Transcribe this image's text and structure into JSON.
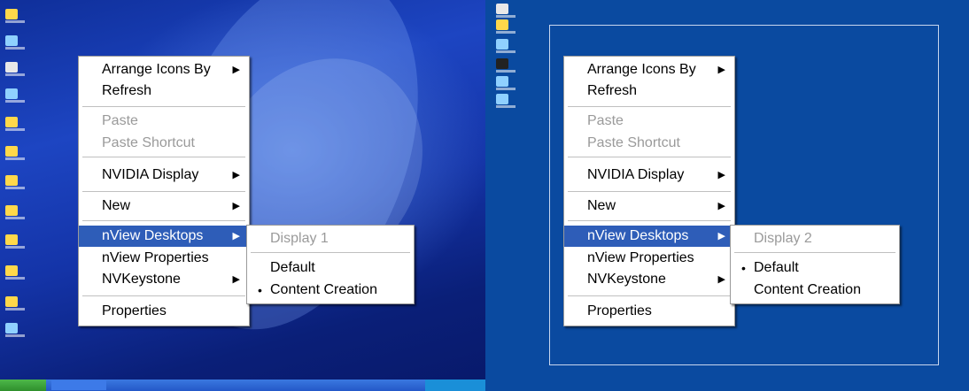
{
  "left_menu": {
    "items": [
      {
        "label": "Arrange Icons By",
        "submenu": true
      },
      {
        "label": "Refresh"
      },
      {
        "label": "Paste",
        "disabled": true
      },
      {
        "label": "Paste Shortcut",
        "disabled": true
      },
      {
        "label": "NVIDIA Display",
        "submenu": true
      },
      {
        "label": "New",
        "submenu": true
      },
      {
        "label": "nView Desktops",
        "submenu": true,
        "highlighted": true
      },
      {
        "label": "nView Properties"
      },
      {
        "label": "NVKeystone",
        "submenu": true
      },
      {
        "label": "Properties"
      }
    ],
    "submenu": {
      "header": "Display 1",
      "items": [
        {
          "label": "Default",
          "checked": false
        },
        {
          "label": "Content Creation",
          "checked": true
        }
      ]
    }
  },
  "right_menu": {
    "items": [
      {
        "label": "Arrange Icons By",
        "submenu": true
      },
      {
        "label": "Refresh"
      },
      {
        "label": "Paste",
        "disabled": true
      },
      {
        "label": "Paste Shortcut",
        "disabled": true
      },
      {
        "label": "NVIDIA Display",
        "submenu": true
      },
      {
        "label": "New",
        "submenu": true
      },
      {
        "label": "nView Desktops",
        "submenu": true,
        "highlighted": true
      },
      {
        "label": "nView Properties"
      },
      {
        "label": "NVKeystone",
        "submenu": true
      },
      {
        "label": "Properties"
      }
    ],
    "submenu": {
      "header": "Display 2",
      "items": [
        {
          "label": "Default",
          "checked": true
        },
        {
          "label": "Content Creation",
          "checked": false
        }
      ]
    }
  },
  "glyphs": {
    "arrow": "▶",
    "bullet": "•"
  },
  "colors": {
    "highlight": "#2e5db8",
    "disabled": "#9a9a9a",
    "left_desktop": "#1d45c2",
    "right_desktop": "#0a4aa0"
  }
}
